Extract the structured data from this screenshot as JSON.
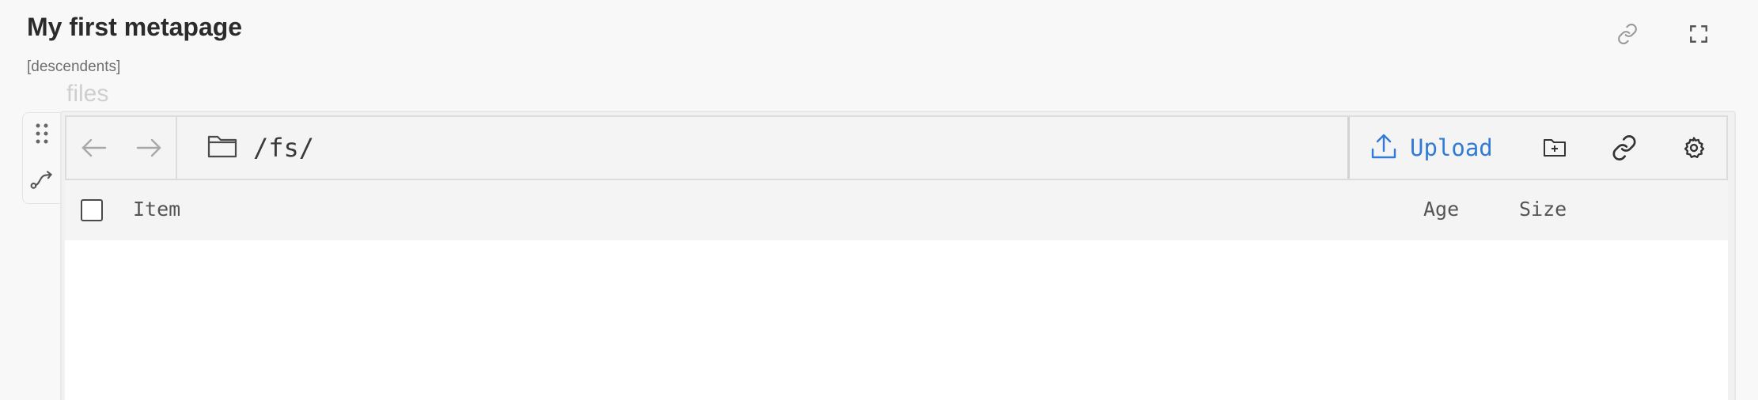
{
  "page": {
    "title": "My first metapage",
    "subtitle": "[descendents]",
    "frame_label": "files"
  },
  "toolbar": {
    "path": "/fs/",
    "upload_label": "Upload"
  },
  "table": {
    "columns": [
      "Item",
      "Age",
      "Size"
    ]
  },
  "icons": {
    "top_right": [
      "link-icon",
      "fullscreen-icon"
    ],
    "handle": [
      "drag-handle-icon",
      "connection-icon"
    ],
    "nav": [
      "arrow-left-icon",
      "arrow-right-icon"
    ],
    "path": "folder-icon",
    "actions": [
      "upload-icon",
      "new-folder-icon",
      "link-icon",
      "gear-icon"
    ]
  },
  "colors": {
    "accent": "#2f7bd6",
    "background": "#f8f8f8",
    "toolbar_bg": "#f4f4f4",
    "content_bg": "#ffffff"
  }
}
